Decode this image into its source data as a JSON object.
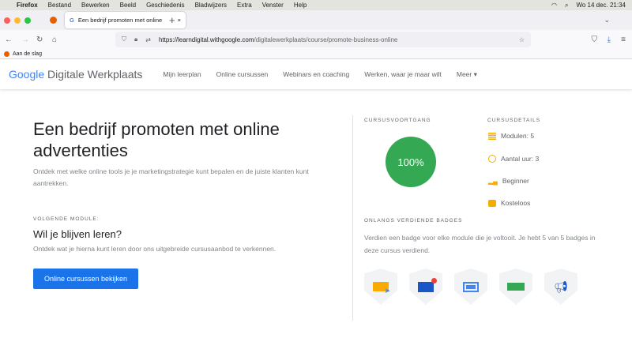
{
  "menubar": {
    "items": [
      "Firefox",
      "Bestand",
      "Bewerken",
      "Beeld",
      "Geschiedenis",
      "Bladwijzers",
      "Extra",
      "Venster",
      "Help"
    ],
    "clock": "Wo 14 dec.  21:34"
  },
  "tab": {
    "title": "Een bedrijf promoten met online"
  },
  "url": {
    "host": "https://learndigital.withgoogle.com",
    "path": "/digitalewerkplaats/course/promote-business-online"
  },
  "bookmarks": [
    "Aan de slag"
  ],
  "site": {
    "logo_google": "Google",
    "logo_text": "Digitale Werkplaats",
    "nav": [
      "Mijn leerplan",
      "Online cursussen",
      "Webinars en coaching",
      "Werken, waar je maar wilt",
      "Meer"
    ]
  },
  "course": {
    "title": "Een bedrijf promoten met online advertenties",
    "description": "Ontdek met welke online tools je je marketingstrategie kunt bepalen en de juiste klanten kunt aantrekken.",
    "next_label": "VOLGENDE MODULE:",
    "next_title": "Wil je blijven leren?",
    "next_text": "Ontdek wat je hierna kunt leren door ons uitgebreide cursusaanbod te verkennen.",
    "button": "Online cursussen bekijken"
  },
  "progress": {
    "label": "CURSUSVOORTGANG",
    "value": "100%",
    "fraction": 1.0
  },
  "details": {
    "label": "CURSUSDETAILS",
    "items": [
      "Modulen: 5",
      "Aantal uur: 3",
      "Beginner",
      "Kosteloos"
    ]
  },
  "badges": {
    "label": "ONLANGS VERDIENDE BADGES",
    "text": "Verdien een badge voor elke module die je voltooit. Je hebt 5 van 5 badges in deze cursus verdiend.",
    "icons": [
      "ad-click-icon",
      "email-icon",
      "laptop-icon",
      "display-ad-icon",
      "megaphone-icon"
    ]
  },
  "colors": {
    "accent": "#1a73e8",
    "progress": "#34a853",
    "detail_icon": "#f9ab00"
  }
}
